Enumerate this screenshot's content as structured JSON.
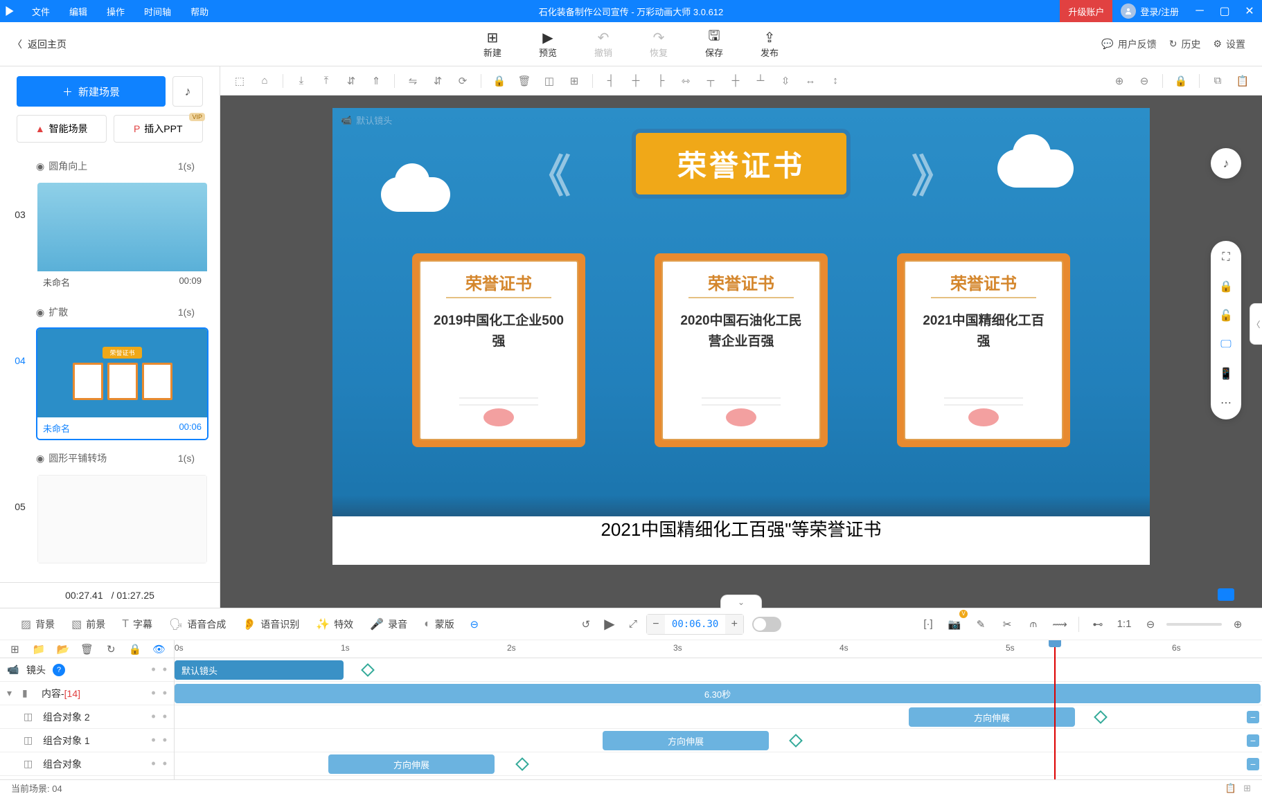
{
  "title_bar": {
    "menus": {
      "file": "文件",
      "edit": "编辑",
      "action": "操作",
      "timeline": "时间轴",
      "help": "帮助"
    },
    "doc_title": "石化装备制作公司宣传 - 万彩动画大师 3.0.612",
    "upgrade": "升级账户",
    "login": "登录/注册"
  },
  "top_toolbar": {
    "back": "返回主页",
    "actions": {
      "new": "新建",
      "preview": "预览",
      "undo": "撤销",
      "redo": "恢复",
      "save": "保存",
      "publish": "发布"
    },
    "right": {
      "feedback": "用户反馈",
      "history": "历史",
      "settings": "设置"
    }
  },
  "left_panel": {
    "new_scene": "新建场景",
    "smart_scene": "智能场景",
    "insert_ppt": "插入PPT",
    "vip": "VIP",
    "transitions": {
      "t1": {
        "name": "圆角向上",
        "dur": "1(s)"
      },
      "t2": {
        "name": "扩散",
        "dur": "1(s)"
      },
      "t3": {
        "name": "圆形平铺转场",
        "dur": "1(s)"
      }
    },
    "scenes": {
      "s3": {
        "num": "03",
        "name": "未命名",
        "time": "00:09"
      },
      "s4": {
        "num": "04",
        "name": "未命名",
        "time": "00:06"
      },
      "s5": {
        "num": "05"
      }
    },
    "footer": {
      "current": "00:27.41",
      "total": "/ 01:27.25"
    }
  },
  "stage": {
    "camera_label": "默认镜头",
    "banner": "荣誉证书",
    "cert_header": "荣誉证书",
    "cert1": "2019中国化工企业500强",
    "cert2": "2020中国石油化工民营企业百强",
    "cert3": "2021中国精细化工百强",
    "caption": "2021中国精细化工百强\"等荣誉证书"
  },
  "timeline": {
    "toolbar": {
      "bg": "背景",
      "fg": "前景",
      "subtitle": "字幕",
      "tts": "语音合成",
      "asr": "语音识别",
      "fx": "特效",
      "record": "录音",
      "mask": "蒙版"
    },
    "time_value": "00:06.30",
    "ticks": {
      "t0": "0s",
      "t1": "1s",
      "t2": "2s",
      "t3": "3s",
      "t4": "4s",
      "t5": "5s",
      "t6": "6s"
    },
    "rows": {
      "camera": "镜头",
      "content": "内容-",
      "content_count": "[14]",
      "obj2": "组合对象 2",
      "obj1": "组合对象 1",
      "obj0": "组合对象"
    },
    "blocks": {
      "default_camera": "默认镜头",
      "duration": "6.30秒",
      "extend2": "方向伸展",
      "extend1": "方向伸展",
      "extend0": "方向伸展"
    }
  },
  "status_bar": {
    "current_scene": "当前场景: 04"
  }
}
